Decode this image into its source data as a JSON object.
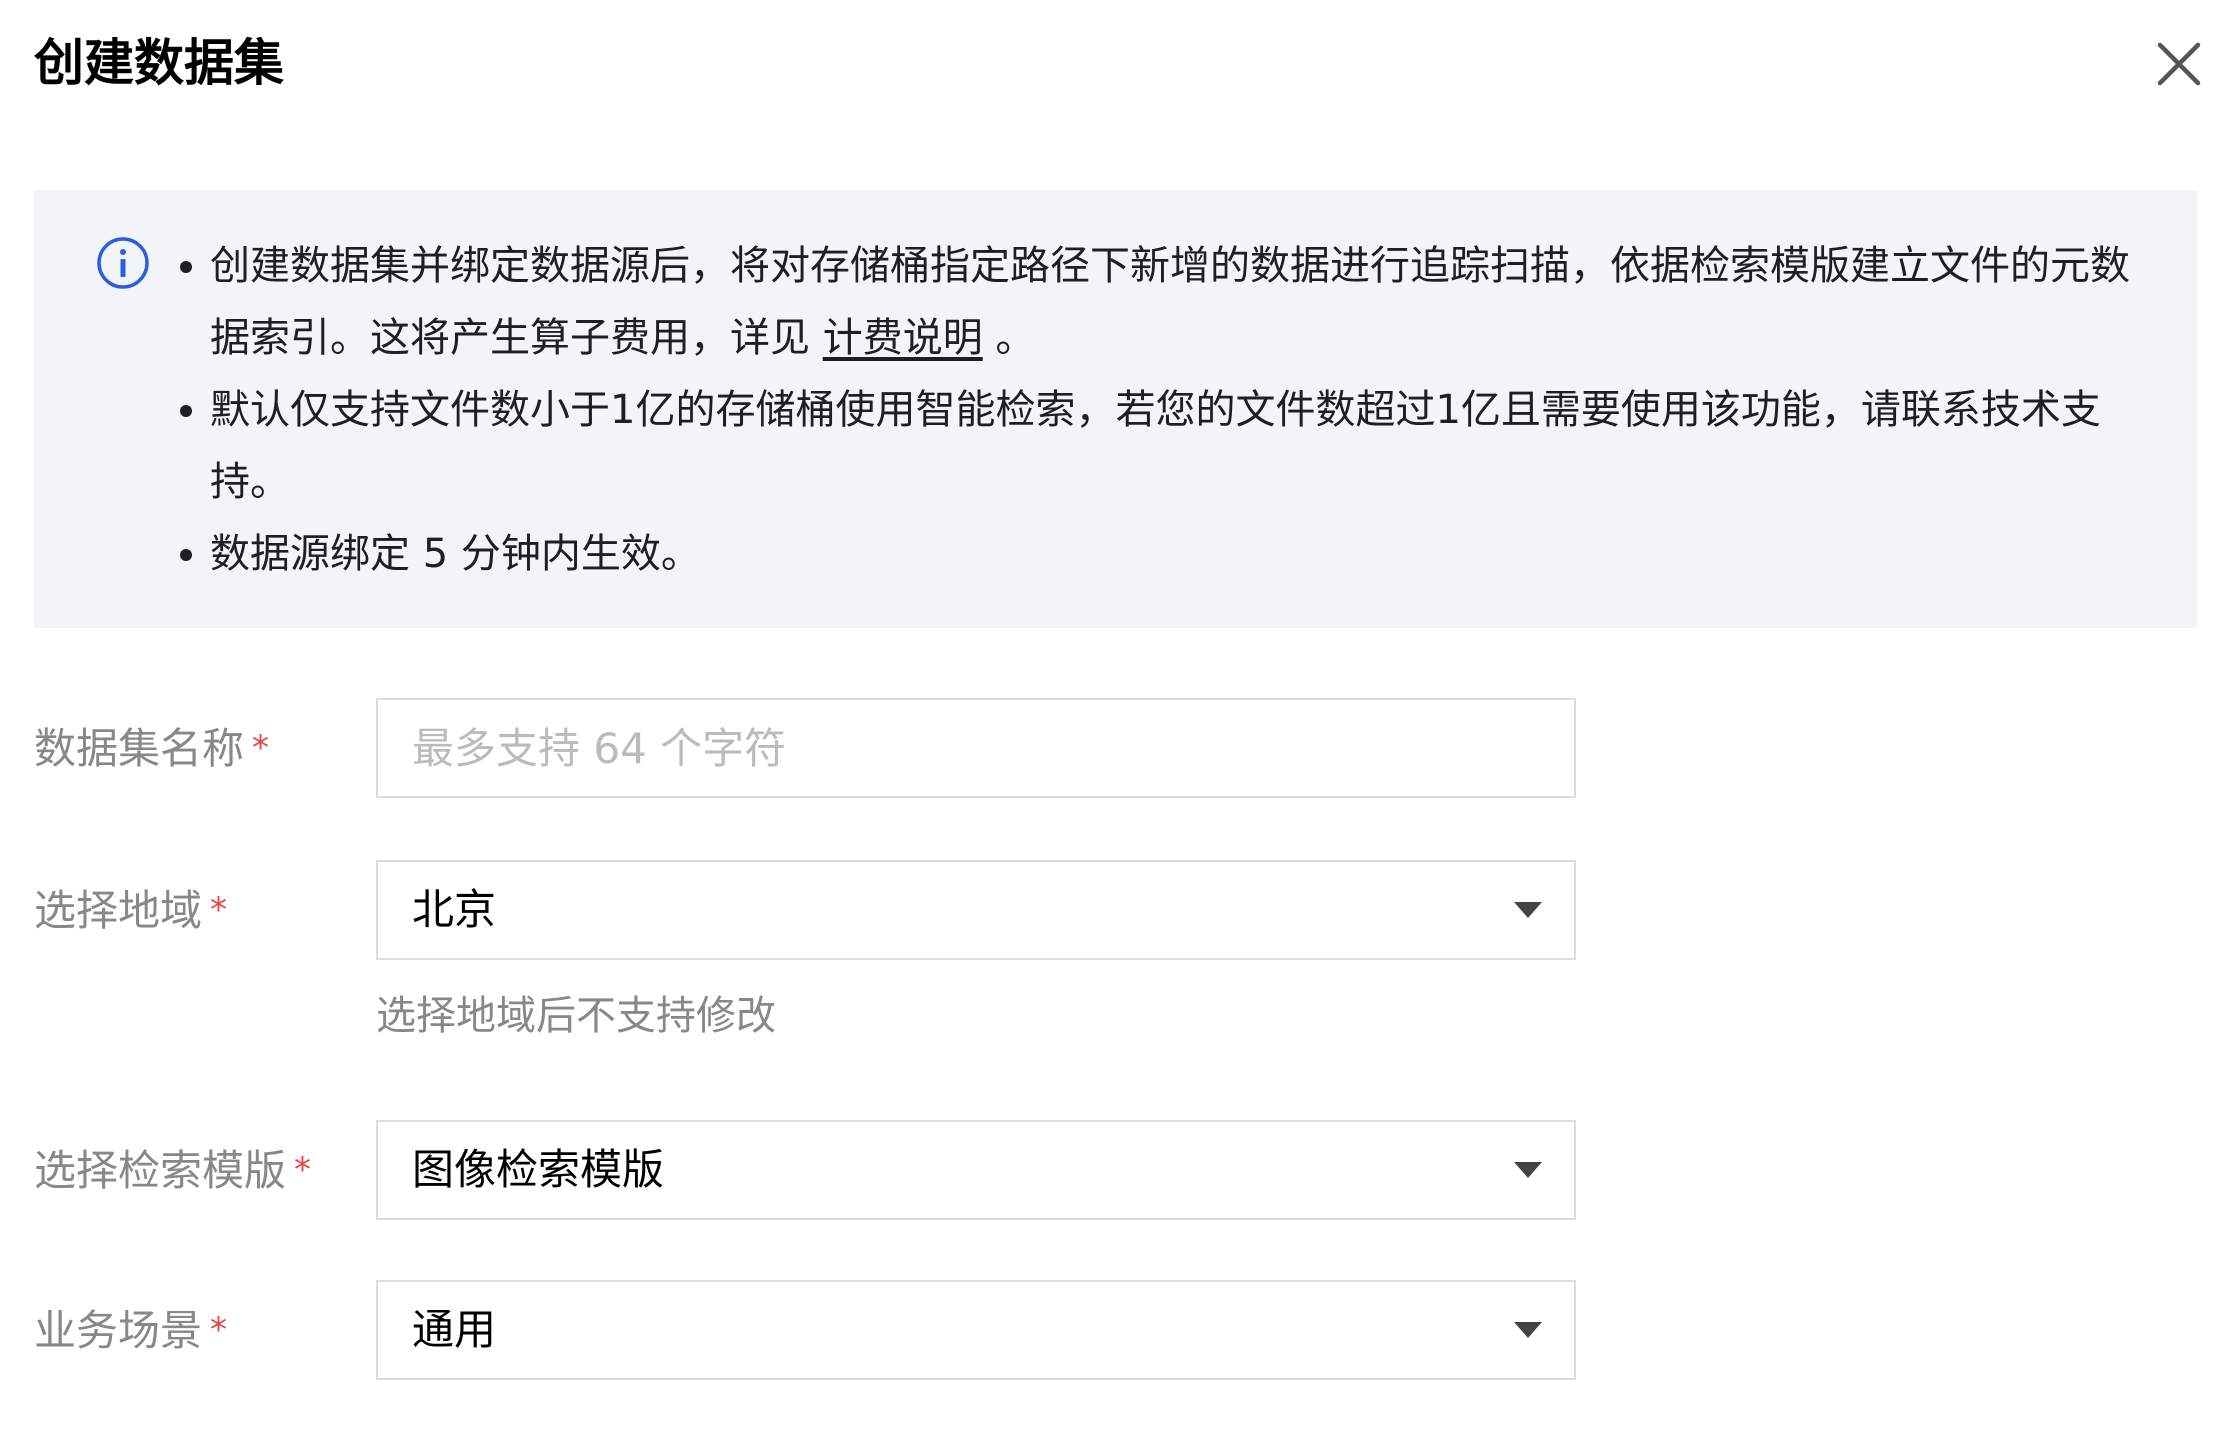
{
  "dialog": {
    "title": "创建数据集"
  },
  "notice": {
    "items": [
      {
        "text_before": "创建数据集并绑定数据源后，将对存储桶指定路径下新增的数据进行追踪扫描，依据检索模版建立文件的元数据索引。这将产生算子费用，详见 ",
        "link": "计费说明",
        "text_after": " 。"
      },
      {
        "text": "默认仅支持文件数小于1亿的存储桶使用智能检索，若您的文件数超过1亿且需要使用该功能，请联系技术支持。"
      },
      {
        "text": "数据源绑定 5 分钟内生效。"
      }
    ]
  },
  "form": {
    "dataset_name": {
      "label": "数据集名称",
      "required": "*",
      "placeholder": "最多支持 64 个字符",
      "value": ""
    },
    "region": {
      "label": "选择地域",
      "required": "*",
      "value": "北京",
      "hint": "选择地域后不支持修改"
    },
    "template": {
      "label": "选择检索模版",
      "required": "*",
      "value": "图像检索模版"
    },
    "scenario": {
      "label": "业务场景",
      "required": "*",
      "value": "通用"
    }
  },
  "colors": {
    "required": "#e54545",
    "info_icon": "#2b5ce6",
    "notice_bg": "#f3f4f8"
  }
}
